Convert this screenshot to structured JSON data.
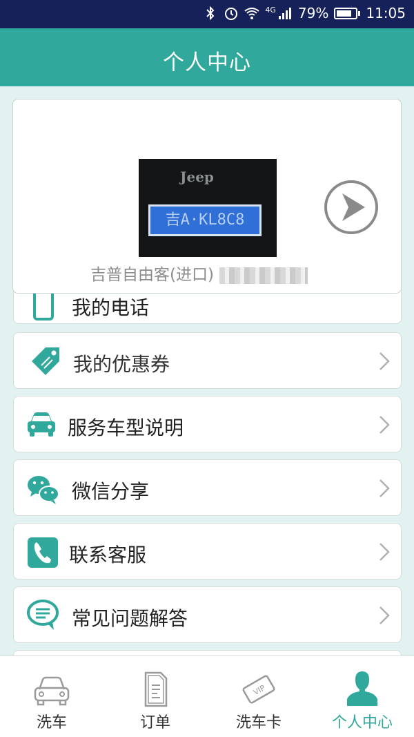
{
  "status_bar": {
    "signal_label": "4G",
    "battery": "79%",
    "battery_level": 0.79,
    "time": "11:05"
  },
  "header": {
    "title": "个人中心"
  },
  "car_card": {
    "brand_badge": "Jeep",
    "plate_text": "吉A·KL8C8",
    "description": "吉普自由客(进口)"
  },
  "menu": {
    "partial_label": "我的电话",
    "items": [
      {
        "label": "我的优惠券",
        "icon": "coupon-tag-icon"
      },
      {
        "label": "服务车型说明",
        "icon": "car-icon"
      },
      {
        "label": "微信分享",
        "icon": "wechat-icon"
      },
      {
        "label": "联系客服",
        "icon": "phone-icon"
      },
      {
        "label": "常见问题解答",
        "icon": "faq-chat-icon"
      }
    ]
  },
  "tabs": [
    {
      "label": "洗车",
      "icon": "car-outline-icon",
      "active": false
    },
    {
      "label": "订单",
      "icon": "document-icon",
      "active": false
    },
    {
      "label": "洗车卡",
      "icon": "vip-card-icon",
      "active": false
    },
    {
      "label": "个人中心",
      "icon": "person-icon",
      "active": true
    }
  ],
  "colors": {
    "accent": "#31a89c",
    "status_bar": "#16215a",
    "background": "#e2f2f0"
  }
}
